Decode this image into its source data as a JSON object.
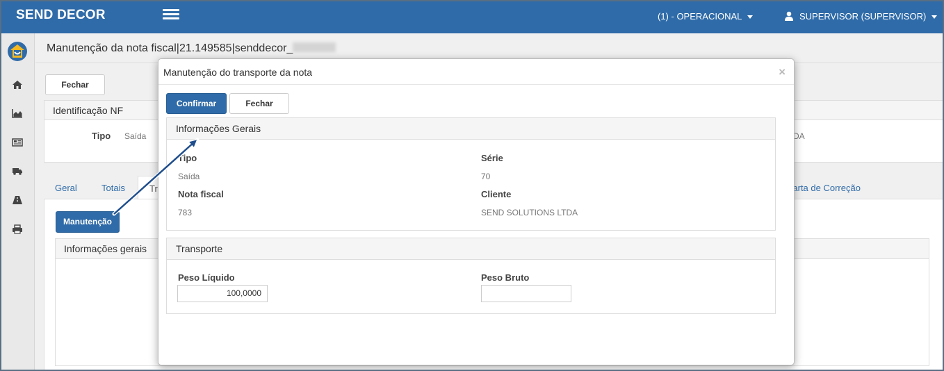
{
  "navbar": {
    "brand": "SEND DECOR",
    "operation": "(1) - OPERACIONAL",
    "user": "SUPERVISOR (SUPERVISOR)"
  },
  "sidebar": {
    "icons": [
      "logo-icon",
      "home-icon",
      "area-chart-icon",
      "newspaper-icon",
      "truck-icon",
      "road-icon",
      "print-icon"
    ]
  },
  "page": {
    "title": "Manutenção da nota fiscal|21.149585|senddecor_",
    "close_button": "Fechar",
    "ident_panel_title": "Identificação NF",
    "tipo_label": "Tipo",
    "tipo_value": "Saída",
    "partial_text": "DA",
    "tabs": [
      "Geral",
      "Totais",
      "Tr",
      "Carta de Correção"
    ],
    "maintenance_button": "Manutenção",
    "info_panel_title": "Informações gerais"
  },
  "modal": {
    "title": "Manutenção do transporte da nota",
    "close_symbol": "×",
    "confirm_button": "Confirmar",
    "close_button": "Fechar",
    "general": {
      "title": "Informações Gerais",
      "tipo_label": "Tipo",
      "tipo_value": "Saída",
      "serie_label": "Série",
      "serie_value": "70",
      "nota_label": "Nota fiscal",
      "nota_value": "783",
      "cliente_label": "Cliente",
      "cliente_value": "SEND SOLUTIONS LTDA"
    },
    "transport": {
      "title": "Transporte",
      "peso_liquido_label": "Peso Líquido",
      "peso_liquido_value": "100,0000",
      "peso_bruto_label": "Peso Bruto",
      "peso_bruto_value": ""
    }
  },
  "colors": {
    "primary": "#2f6ba8",
    "arrow": "#1f4e8c"
  }
}
